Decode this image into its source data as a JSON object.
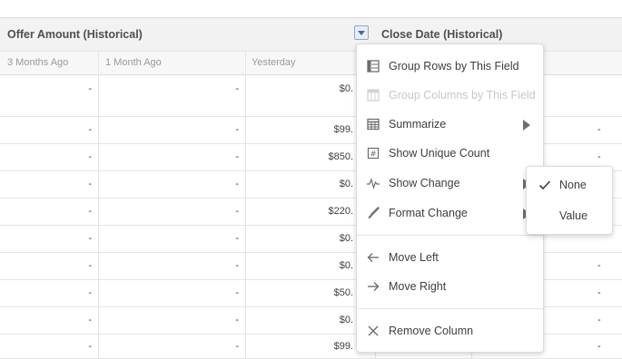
{
  "header": {
    "offer_amount": "Offer Amount (Historical)",
    "close_date": "Close Date (Historical)"
  },
  "subheader": {
    "col1": "3 Months Ago",
    "col2": "1 Month Ago",
    "col3": "Yesterday"
  },
  "rows": [
    {
      "c1": "-",
      "c2": "-",
      "c3": "$0.",
      "c5": ""
    },
    {
      "c1": "-",
      "c2": "-",
      "c3": "$99.",
      "c5": "-"
    },
    {
      "c1": "-",
      "c2": "-",
      "c3": "$850.",
      "c5": "-"
    },
    {
      "c1": "-",
      "c2": "-",
      "c3": "$0.",
      "c5": "-"
    },
    {
      "c1": "-",
      "c2": "-",
      "c3": "$220.",
      "c5": ""
    },
    {
      "c1": "-",
      "c2": "-",
      "c3": "$0.",
      "c5": ""
    },
    {
      "c1": "-",
      "c2": "-",
      "c3": "$0.",
      "c5": "-"
    },
    {
      "c1": "-",
      "c2": "-",
      "c3": "$50.",
      "c5": "-"
    },
    {
      "c1": "-",
      "c2": "-",
      "c3": "$0.",
      "c5": "-"
    },
    {
      "c1": "-",
      "c2": "-",
      "c3": "$99.",
      "c5": "-"
    }
  ],
  "menu": {
    "group_rows": "Group Rows by This Field",
    "group_columns": "Group Columns by This Field",
    "summarize": "Summarize",
    "show_unique_count": "Show Unique Count",
    "show_change": "Show Change",
    "format_change": "Format Change",
    "move_left": "Move Left",
    "move_right": "Move Right",
    "remove_column": "Remove Column"
  },
  "submenu": {
    "none": "None",
    "value": "Value",
    "selected": "None"
  },
  "colors": {
    "accent": "#3f6ba8",
    "check": "#3e3e3c"
  }
}
